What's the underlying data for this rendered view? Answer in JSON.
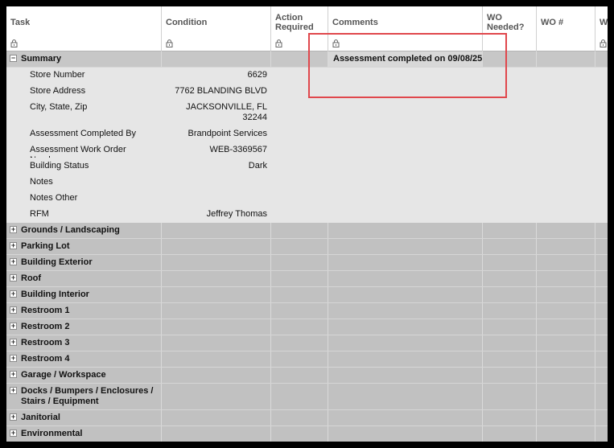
{
  "columns": [
    {
      "label": "Task"
    },
    {
      "label": "Condition"
    },
    {
      "label": "Action\nRequired"
    },
    {
      "label": "Comments"
    },
    {
      "label": "WO\nNeeded?"
    },
    {
      "label": "WO #"
    },
    {
      "label": "W"
    }
  ],
  "summary": {
    "label": "Summary",
    "toggle": "−",
    "comment": "Assessment completed on 09/08/25",
    "details": [
      {
        "label": "Store Number",
        "value": "6629"
      },
      {
        "label": "Store Address",
        "value": "7762 BLANDING BLVD"
      },
      {
        "label": "City, State, Zip",
        "value": "JACKSONVILLE, FL\n32244"
      },
      {
        "label": "Assessment Completed By",
        "value": "Brandpoint Services"
      },
      {
        "label": "Assessment Work Order Number",
        "value": "WEB-3369567"
      },
      {
        "label": "Building Status",
        "value": "Dark"
      },
      {
        "label": "Notes",
        "value": ""
      },
      {
        "label": "Notes Other",
        "value": ""
      },
      {
        "label": "RFM",
        "value": "Jeffrey Thomas"
      }
    ]
  },
  "groups": [
    {
      "label": "Grounds / Landscaping",
      "toggle": "+"
    },
    {
      "label": "Parking Lot",
      "toggle": "+"
    },
    {
      "label": "Building Exterior",
      "toggle": "+"
    },
    {
      "label": "Roof",
      "toggle": "+"
    },
    {
      "label": "Building Interior",
      "toggle": "+"
    },
    {
      "label": "Restroom 1",
      "toggle": "+"
    },
    {
      "label": "Restroom 2",
      "toggle": "+"
    },
    {
      "label": "Restroom 3",
      "toggle": "+"
    },
    {
      "label": "Restroom 4",
      "toggle": "+"
    },
    {
      "label": "Garage / Workspace",
      "toggle": "+"
    },
    {
      "label": "Docks / Bumpers / Enclosures / Stairs / Equipment",
      "toggle": "+"
    },
    {
      "label": "Janitorial",
      "toggle": "+"
    },
    {
      "label": "Environmental",
      "toggle": "+"
    }
  ],
  "colors": {
    "highlight": "#e0474c",
    "group_row": "#c1c1c1",
    "detail_row": "#e6e6e6"
  }
}
